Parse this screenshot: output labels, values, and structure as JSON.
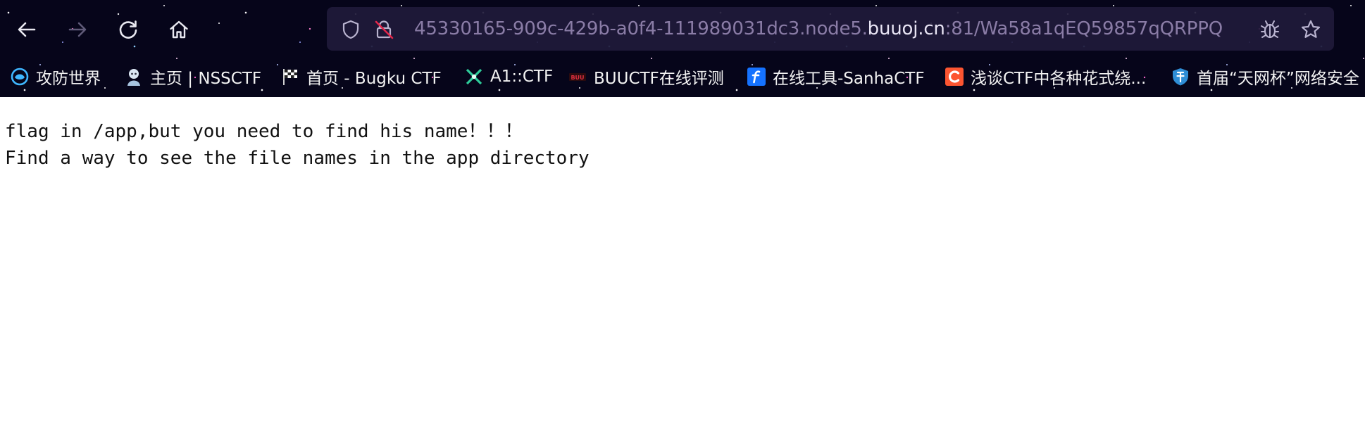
{
  "browser": {
    "url_prefix": "45330165-909c-429b-a0f4-111989031dc3.node5.",
    "url_domain": "buuoj.cn",
    "url_suffix": ":81/Wa58a1qEQ59857qQRPPQ",
    "nav_icons": [
      "back-arrow-icon",
      "forward-arrow-icon",
      "reload-icon",
      "home-icon"
    ],
    "url_icons": [
      "shield-icon",
      "insecure-lock-icon",
      "bug-icon",
      "star-icon"
    ],
    "colors": {
      "chrome_bg": "#06051a",
      "url_bar_bg": "#201a3a",
      "url_text": "#8a7ca6",
      "url_domain": "#e8e4f4"
    }
  },
  "bookmarks": [
    {
      "label": "攻防世界",
      "icon": "gongfang-logo-icon"
    },
    {
      "label": "主页 | NSSCTF",
      "icon": "nssctf-logo-icon"
    },
    {
      "label": "首页 - Bugku CTF",
      "icon": "checkered-flag-icon"
    },
    {
      "label": "A1::CTF",
      "icon": "a1ctf-logo-icon"
    },
    {
      "label": "BUUCTF在线评测",
      "icon": "buuctf-logo-icon"
    },
    {
      "label": "在线工具-SanhaCTF",
      "icon": "f-logo-icon"
    },
    {
      "label": "浅谈CTF中各种花式绕...",
      "icon": "c-logo-icon"
    },
    {
      "label": "首届“天网杯”网络安全",
      "icon": "tianwang-logo-icon"
    }
  ],
  "page": {
    "lines": [
      "flag in /app,but you need to find his name！！！",
      "Find a way to see the file names in the app directory"
    ]
  }
}
